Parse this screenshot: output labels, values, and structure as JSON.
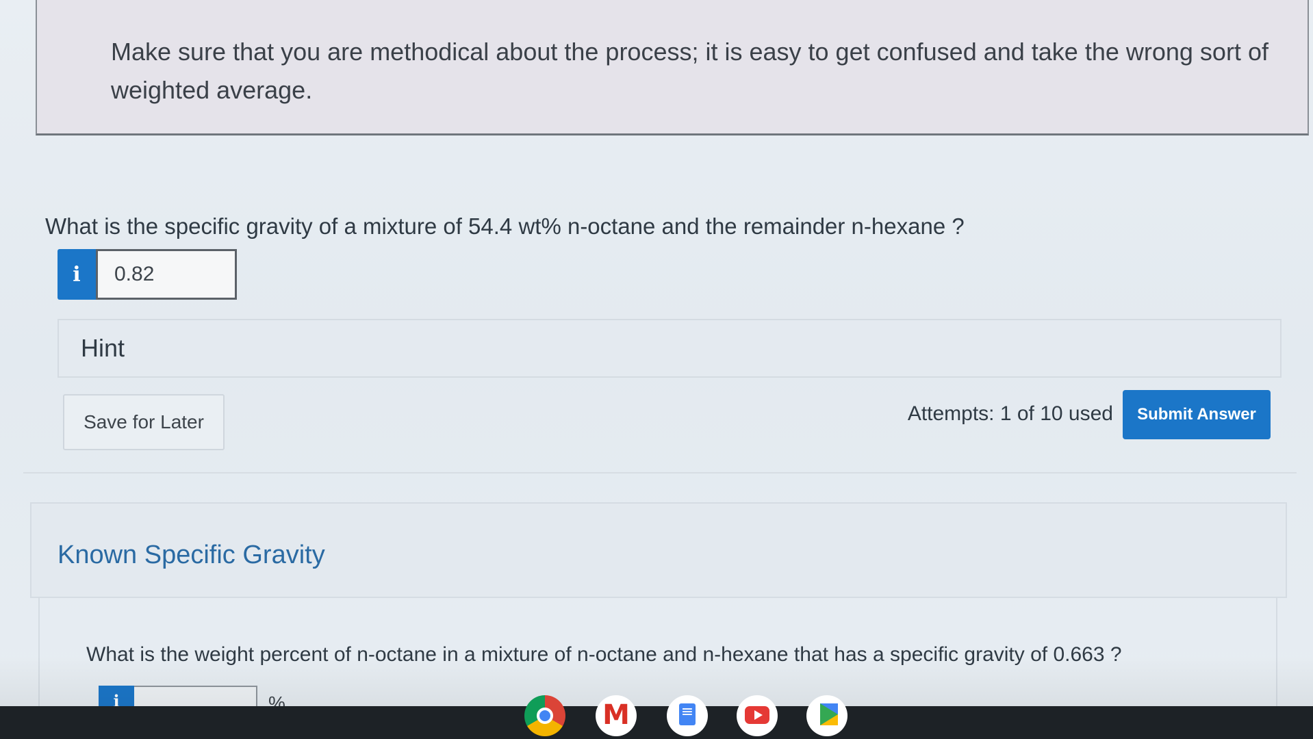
{
  "instructions": {
    "text": "Make sure that you are methodical about the process; it is easy to get confused and take the wrong sort of weighted average."
  },
  "question1": {
    "prompt": "What is the specific gravity of a mixture of 54.4 wt% n-octane and the remainder n-hexane ?",
    "info_glyph": "i",
    "answer_value": "0.82"
  },
  "hint": {
    "label": "Hint"
  },
  "actions": {
    "save_label": "Save for Later",
    "attempts_text": "Attempts: 1 of 10 used",
    "submit_label": "Submit Answer",
    "accent_color": "#1b76c8"
  },
  "section2": {
    "title": "Known Specific Gravity",
    "question": "What is the weight percent of n-octane in a mixture of n-octane and n-hexane that has a specific gravity of 0.663 ?",
    "info_glyph": "i",
    "answer_value": "",
    "unit": "%"
  },
  "taskbar": {
    "apps": [
      "chrome-icon",
      "gmail-icon",
      "docs-icon",
      "youtube-icon",
      "play-store-icon"
    ]
  }
}
